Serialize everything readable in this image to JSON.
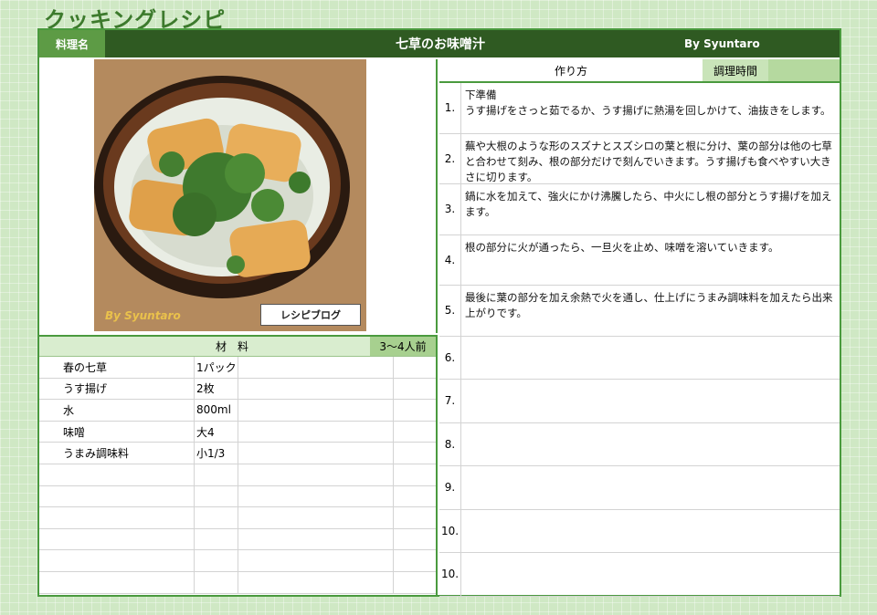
{
  "app_title": "クッキングレシピ",
  "header": {
    "label": "料理名",
    "dish_name": "七草のお味噌汁",
    "author": "By  Syuntaro"
  },
  "photo": {
    "brand_text": "By Syuntaro",
    "badge_text": "レシピブログ"
  },
  "ingredients": {
    "header_title": "材　料",
    "servings": "3〜4人前",
    "rows": [
      {
        "name": "春の七草",
        "qty": "1パック"
      },
      {
        "name": "うす揚げ",
        "qty": "2枚"
      },
      {
        "name": "水",
        "qty": "800ml"
      },
      {
        "name": "味噌",
        "qty": "大4"
      },
      {
        "name": "うまみ調味料",
        "qty": "小1/3"
      },
      {
        "name": "",
        "qty": ""
      },
      {
        "name": "",
        "qty": ""
      },
      {
        "name": "",
        "qty": ""
      },
      {
        "name": "",
        "qty": ""
      },
      {
        "name": "",
        "qty": ""
      },
      {
        "name": "",
        "qty": ""
      }
    ]
  },
  "steps": {
    "header_title": "作り方",
    "time_label": "調理時間",
    "rows": [
      {
        "no": "1.",
        "text": "下準備\nうす揚げをさっと茹でるか、うす揚げに熱湯を回しかけて、油抜きをします。"
      },
      {
        "no": "2.",
        "text": "蕪や大根のような形のスズナとスズシロの葉と根に分け、葉の部分は他の七草と合わせて刻み、根の部分だけで刻んでいきます。うす揚げも食べやすい大きさに切ります。"
      },
      {
        "no": "3.",
        "text": "鍋に水を加えて、強火にかけ沸騰したら、中火にし根の部分とうす揚げを加えます。"
      },
      {
        "no": "4.",
        "text": "根の部分に火が通ったら、一旦火を止め、味噌を溶いていきます。"
      },
      {
        "no": "5.",
        "text": "最後に葉の部分を加え余熱で火を通し、仕上げにうまみ調味料を加えたら出来上がりです。"
      },
      {
        "no": "6.",
        "text": ""
      },
      {
        "no": "7.",
        "text": ""
      },
      {
        "no": "8.",
        "text": ""
      },
      {
        "no": "9.",
        "text": ""
      },
      {
        "no": "10.",
        "text": ""
      },
      {
        "no": "10.",
        "text": ""
      }
    ]
  }
}
